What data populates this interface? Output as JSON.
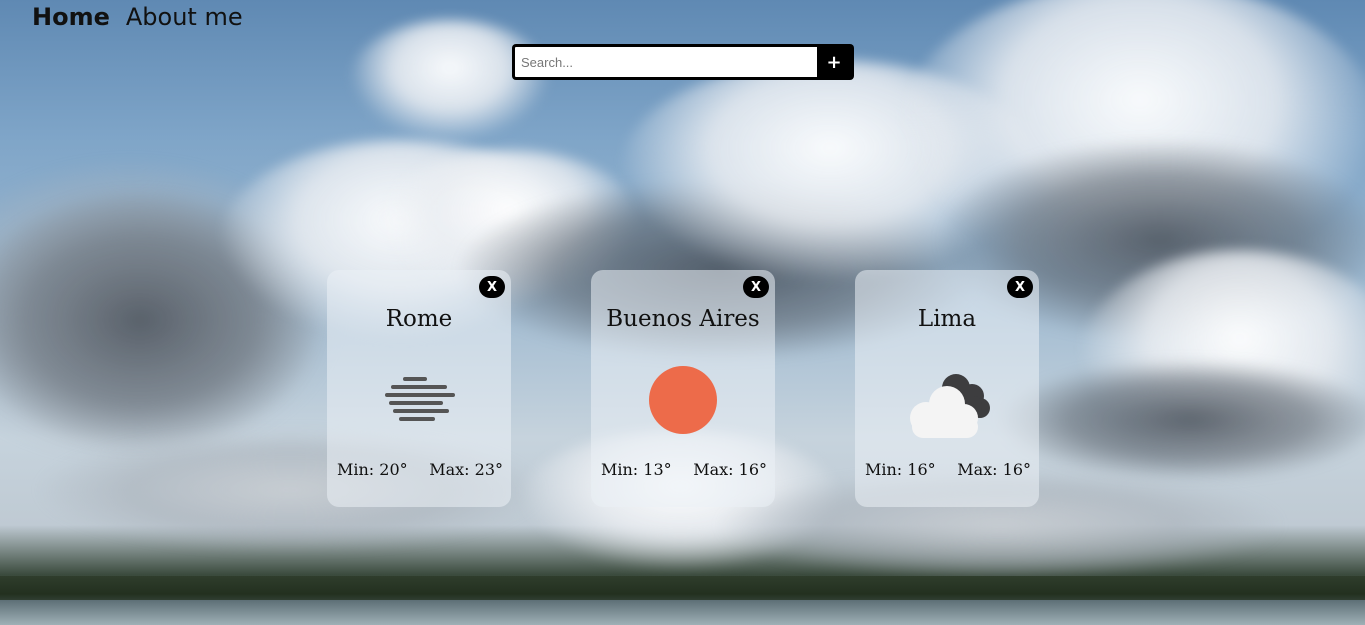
{
  "nav": {
    "home": "Home",
    "about": "About me"
  },
  "search": {
    "placeholder": "Search...",
    "value": "",
    "add_label": "+"
  },
  "cards": [
    {
      "city": "Rome",
      "icon": "mist-icon",
      "min": "Min: 20°",
      "max": "Max: 23°",
      "close_label": "X"
    },
    {
      "city": "Buenos Aires",
      "icon": "sun-icon",
      "min": "Min: 13°",
      "max": "Max: 16°",
      "close_label": "X"
    },
    {
      "city": "Lima",
      "icon": "cloudy-icon",
      "min": "Min: 16°",
      "max": "Max: 16°",
      "close_label": "X"
    }
  ],
  "colors": {
    "sun": "#ed6b4a",
    "close_button_bg": "#000000",
    "card_bg": "rgba(235,240,245,0.55)"
  }
}
